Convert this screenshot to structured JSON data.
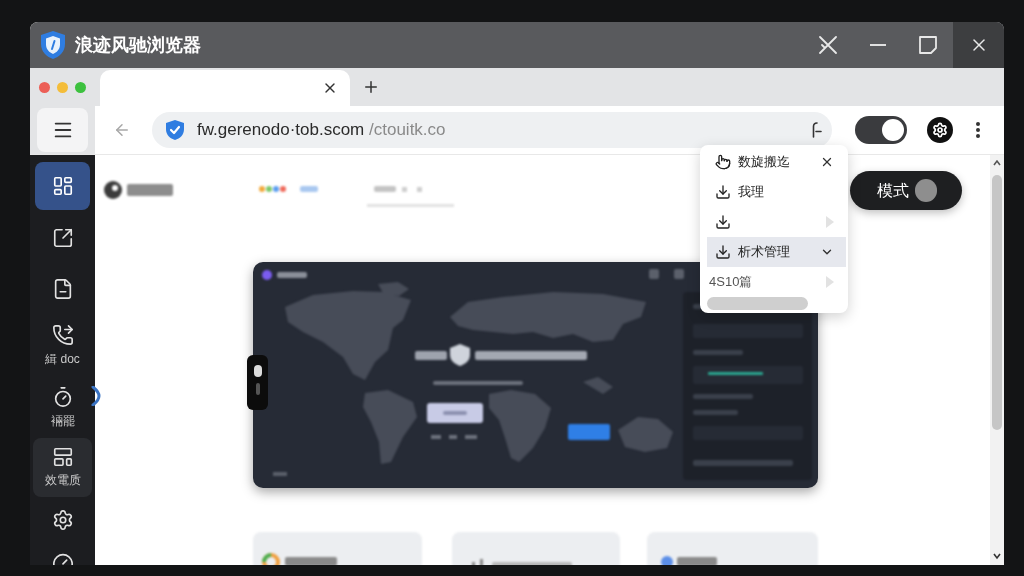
{
  "window": {
    "title": "浪迹风驰浏览器"
  },
  "tabs": [
    {
      "selected": true
    }
  ],
  "address_bar": {
    "url": "fw.gerenodo·tob.scom",
    "path": "/ctouitk.co"
  },
  "toolbar": {
    "toggle": {
      "on": true
    }
  },
  "sidebar": {
    "items": [
      {
        "selected": true,
        "highlighted": false
      },
      {
        "selected": false,
        "highlighted": false
      },
      {
        "selected": false,
        "highlighted": false
      },
      {
        "label": "緝 doc",
        "selected": false,
        "highlighted": false
      },
      {
        "label": "裲罷",
        "selected": false,
        "highlighted": false
      },
      {
        "label": "效電质",
        "selected": false,
        "highlighted": true
      },
      {
        "selected": false,
        "highlighted": false
      },
      {
        "selected": false,
        "highlighted": false
      }
    ]
  },
  "mode_button": {
    "label": "模式"
  },
  "menu": {
    "items": [
      {
        "label": "数旋搬迄",
        "kind": "header",
        "selected": false
      },
      {
        "label": "我理",
        "kind": "item",
        "selected": false
      },
      {
        "kind": "submenu",
        "selected": false
      },
      {
        "label": "析术管理",
        "kind": "expand",
        "selected": true
      },
      {
        "label": "4S10篇",
        "kind": "submenu",
        "selected": false
      }
    ]
  }
}
